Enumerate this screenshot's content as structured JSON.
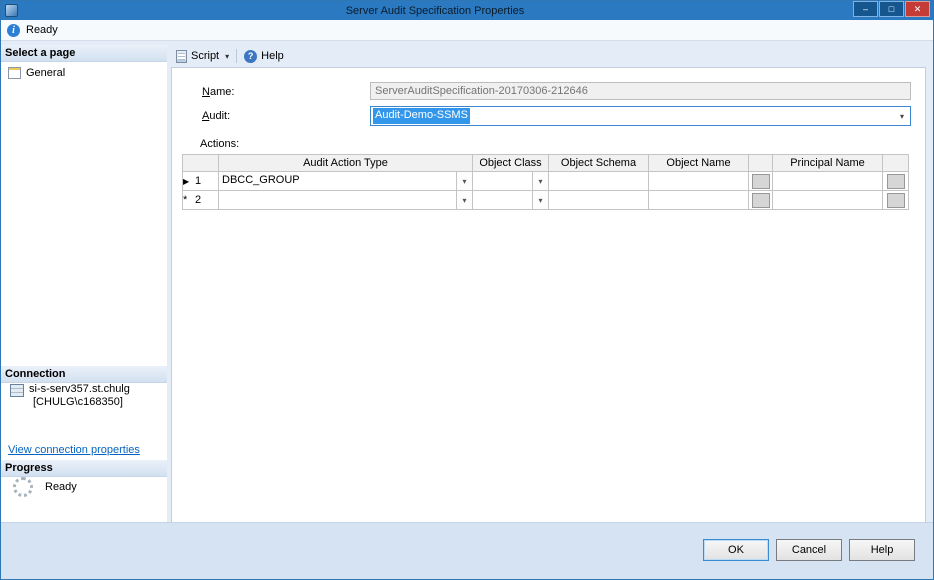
{
  "window": {
    "title": "Server Audit Specification Properties",
    "controls": {
      "minimize": "–",
      "maximize": "□",
      "close": "✕"
    }
  },
  "statusbar": {
    "text": "Ready"
  },
  "toolbar": {
    "script_label": "Script",
    "help_label": "Help"
  },
  "sidebar": {
    "select_page_header": "Select a page",
    "pages": [
      {
        "label": "General"
      }
    ],
    "connection_header": "Connection",
    "connection": {
      "server": "si-s-serv357.st.chulg",
      "login": "[CHULG\\c168350]"
    },
    "view_connection_link": "View connection properties",
    "progress_header": "Progress",
    "progress_status": "Ready"
  },
  "form": {
    "name_label": "Name:",
    "name_value": "ServerAuditSpecification-20170306-212646",
    "audit_label": "Audit:",
    "audit_value": "Audit-Demo-SSMS",
    "actions_label": "Actions:"
  },
  "grid": {
    "columns": [
      "",
      "Audit Action Type",
      "Object Class",
      "Object Schema",
      "Object Name",
      "",
      "Principal Name",
      ""
    ],
    "rows": [
      {
        "marker": "▶",
        "num": "1",
        "audit_action_type": "DBCC_GROUP",
        "object_class": ""
      },
      {
        "marker": "*",
        "num": "2",
        "audit_action_type": "",
        "object_class": ""
      }
    ]
  },
  "footer": {
    "ok_label": "OK",
    "cancel_label": "Cancel",
    "help_label": "Help"
  },
  "icons": {
    "info_glyph": "i",
    "help_glyph": "?",
    "combo_arrow": "▾",
    "script_caret": "▾"
  }
}
